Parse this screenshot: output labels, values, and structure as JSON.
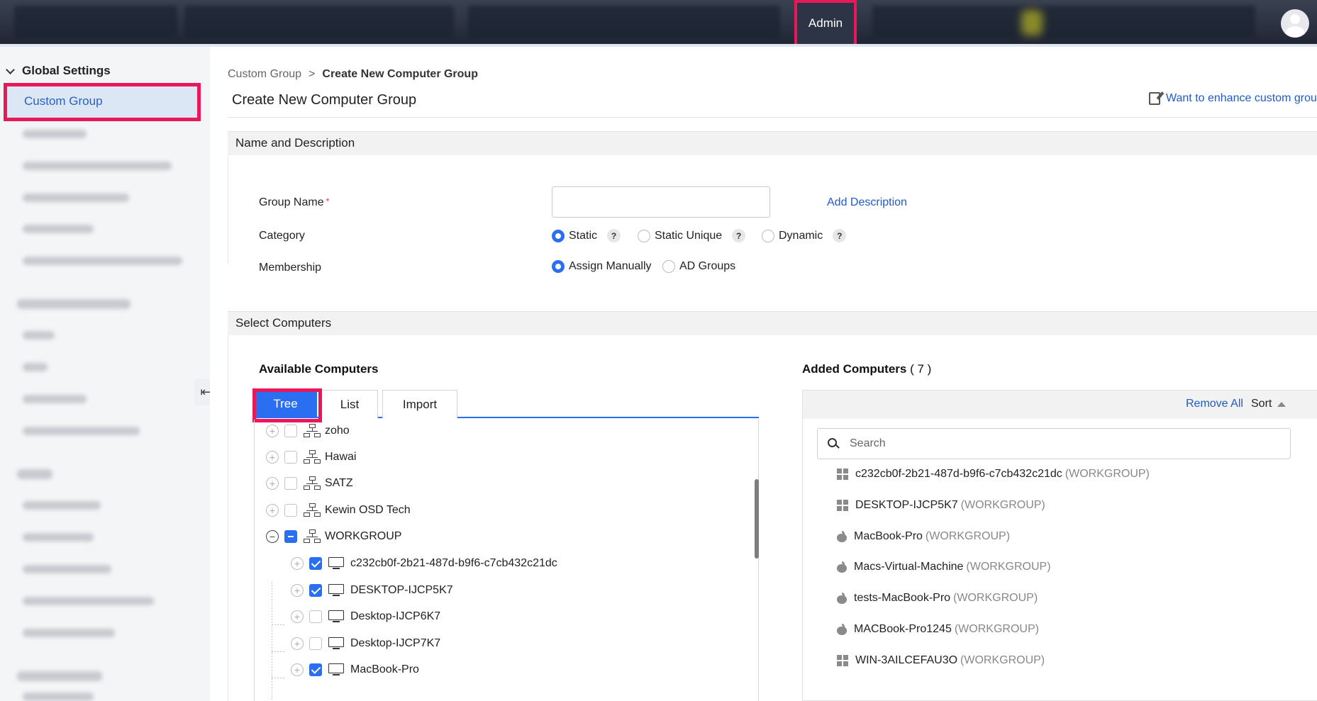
{
  "topbar": {
    "admin_label": "Admin"
  },
  "sidebar": {
    "title": "Global Settings",
    "active_item": "Custom Group"
  },
  "breadcrumb": {
    "parent": "Custom Group",
    "separator": ">",
    "current": "Create New Computer Group"
  },
  "page": {
    "title": "Create New Computer Group",
    "enhance_link": "Want to enhance custom group"
  },
  "name_section": {
    "header": "Name and Description",
    "group_name_label": "Group Name",
    "required_mark": "*",
    "group_name_value": "",
    "add_description": "Add Description",
    "category_label": "Category",
    "category_options": [
      "Static",
      "Static Unique",
      "Dynamic"
    ],
    "category_selected": "Static",
    "help_glyph": "?",
    "membership_label": "Membership",
    "membership_options": [
      "Assign Manually",
      "AD Groups"
    ],
    "membership_selected": "Assign Manually"
  },
  "select_section": {
    "header": "Select Computers",
    "available_title": "Available Computers",
    "added_title": "Added Computers",
    "added_count": "( 7 )",
    "tabs": [
      "Tree",
      "List",
      "Import"
    ],
    "active_tab": "Tree",
    "tree": [
      {
        "label": "zoho",
        "type": "domain",
        "checked": "none",
        "expanded": false
      },
      {
        "label": "Hawai",
        "type": "domain",
        "checked": "none",
        "expanded": false
      },
      {
        "label": "SATZ",
        "type": "domain",
        "checked": "none",
        "expanded": false
      },
      {
        "label": "Kewin OSD Tech",
        "type": "domain",
        "checked": "none",
        "expanded": false
      },
      {
        "label": "WORKGROUP",
        "type": "domain",
        "checked": "partial",
        "expanded": true
      },
      {
        "label": "c232cb0f-2b21-487d-b9f6-c7cb432c21dc",
        "type": "computer",
        "checked": "checked"
      },
      {
        "label": "DESKTOP-IJCP5K7",
        "type": "computer",
        "checked": "checked"
      },
      {
        "label": "Desktop-IJCP6K7",
        "type": "computer",
        "checked": "none"
      },
      {
        "label": "Desktop-IJCP7K7",
        "type": "computer",
        "checked": "none"
      },
      {
        "label": "MacBook-Pro",
        "type": "computer",
        "checked": "checked"
      }
    ],
    "remove_all": "Remove All",
    "sort_label": "Sort",
    "search_placeholder": "Search",
    "added": [
      {
        "name": "c232cb0f-2b21-487d-b9f6-c7cb432c21dc",
        "group": "(WORKGROUP)",
        "os": "windows-icon"
      },
      {
        "name": "DESKTOP-IJCP5K7",
        "group": "(WORKGROUP)",
        "os": "windows-icon"
      },
      {
        "name": "MacBook-Pro",
        "group": "(WORKGROUP)",
        "os": "apple-icon"
      },
      {
        "name": "Macs-Virtual-Machine",
        "group": "(WORKGROUP)",
        "os": "apple-icon"
      },
      {
        "name": "tests-MacBook-Pro",
        "group": "(WORKGROUP)",
        "os": "apple-icon"
      },
      {
        "name": "MACBook-Pro1245",
        "group": "(WORKGROUP)",
        "os": "apple-icon"
      },
      {
        "name": "WIN-3AILCEFAU3O",
        "group": "(WORKGROUP)",
        "os": "windows-icon"
      }
    ]
  },
  "colors": {
    "accent": "#2a6ef2",
    "link": "#1f5bc9",
    "highlight": "#e8185a"
  }
}
